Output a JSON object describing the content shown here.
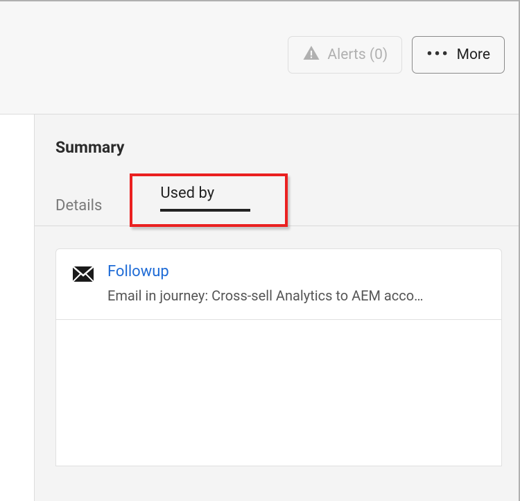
{
  "toolbar": {
    "alerts_label": "Alerts (0)",
    "more_label": "More"
  },
  "panel": {
    "title": "Summary",
    "tabs": {
      "details": "Details",
      "used_by": "Used by"
    },
    "items": [
      {
        "title": "Followup",
        "description": "Email in journey: Cross-sell Analytics to AEM acco…"
      }
    ]
  }
}
